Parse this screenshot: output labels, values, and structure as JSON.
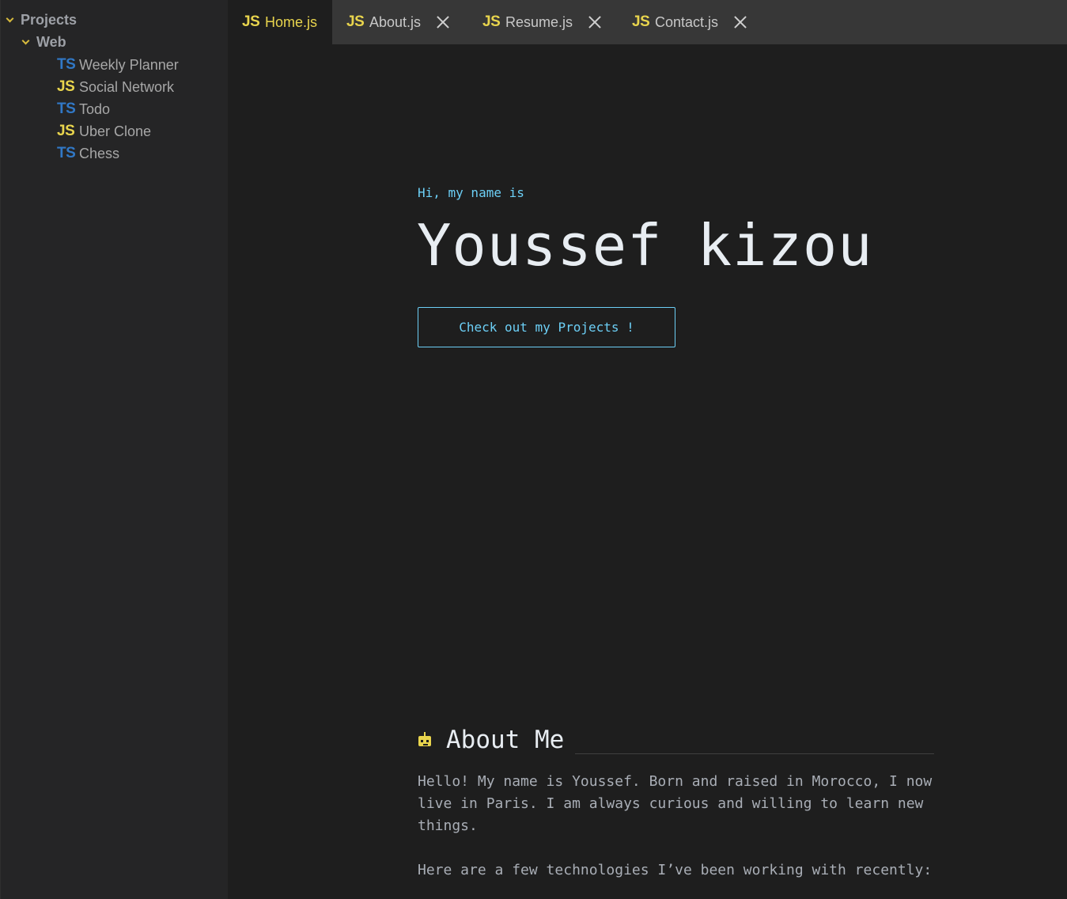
{
  "sidebar": {
    "root": "Projects",
    "folder": "Web",
    "files": [
      {
        "lang": "TS",
        "name": "Weekly Planner"
      },
      {
        "lang": "JS",
        "name": "Social Network"
      },
      {
        "lang": "TS",
        "name": "Todo"
      },
      {
        "lang": "JS",
        "name": "Uber Clone"
      },
      {
        "lang": "TS",
        "name": "Chess"
      }
    ]
  },
  "tabs": [
    {
      "lang": "JS",
      "label": "Home.js"
    },
    {
      "lang": "JS",
      "label": "About.js"
    },
    {
      "lang": "JS",
      "label": "Resume.js"
    },
    {
      "lang": "JS",
      "label": "Contact.js"
    }
  ],
  "hero": {
    "greeting": "Hi, my name is",
    "name": "Youssef kizou",
    "cta": "Check out my Projects !"
  },
  "about": {
    "title": "About Me",
    "paragraph1": "Hello! My name is Youssef. Born and raised in Morocco, I now live in Paris. I am always curious and willing to learn new things.",
    "paragraph2": "Here are a few technologies I’ve been working with recently:"
  },
  "icons": {
    "folder_chevron": "chevron-down-icon",
    "tab_close": "close-icon",
    "about_icon": "robot-icon"
  },
  "colors": {
    "accent_yellow": "#e8d44d",
    "accent_cyan": "#6ccff6",
    "ts_blue": "#3178c6",
    "background": "#1e1e1e",
    "sidebar": "#252526",
    "tabbar": "#373737"
  }
}
